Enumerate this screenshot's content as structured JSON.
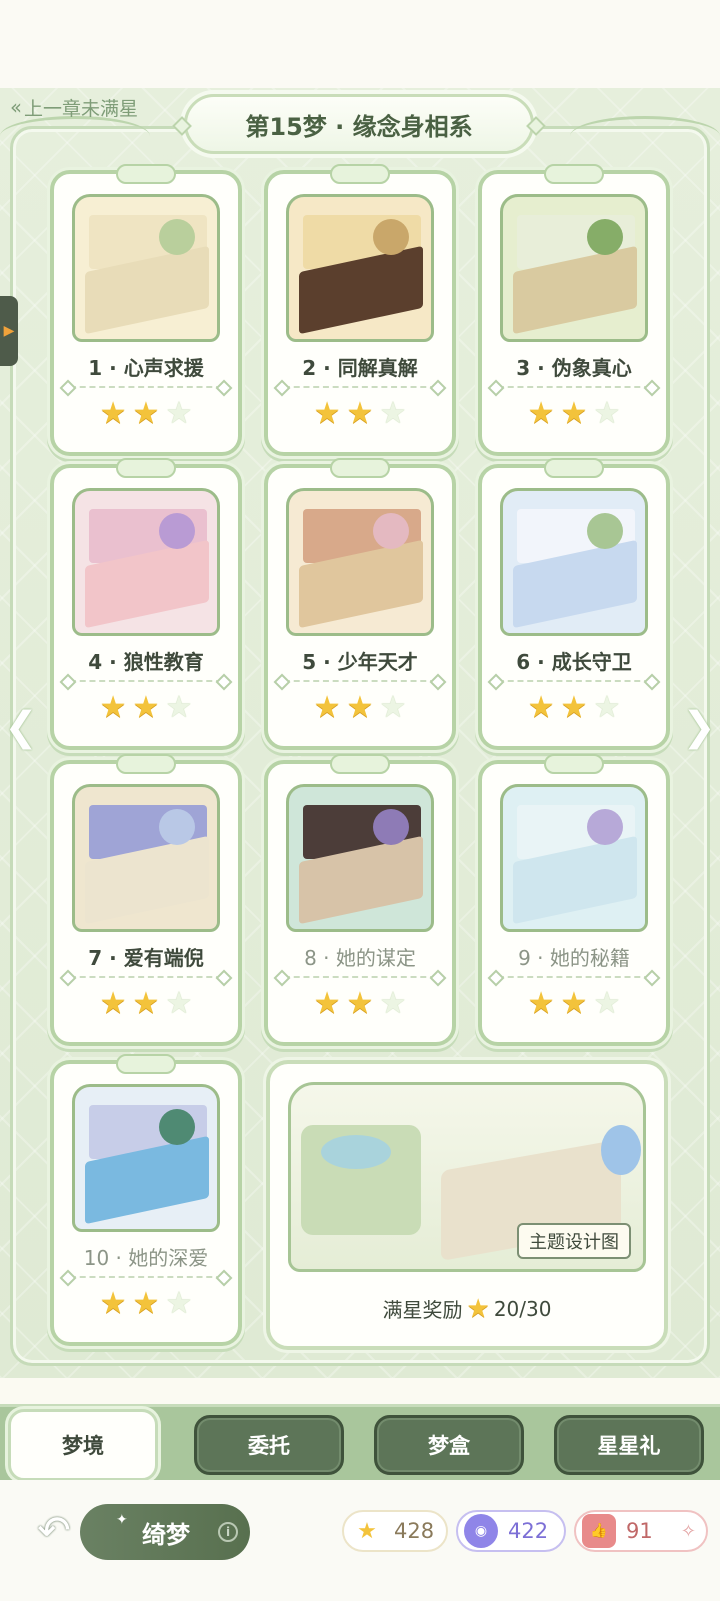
{
  "header": {
    "back_link": "上一章未满星",
    "chapter_title": "第15梦 · 缘念身相系"
  },
  "stages": [
    {
      "label": "1 · 心声求援",
      "stars": 2,
      "theme": "cream"
    },
    {
      "label": "2 · 同解真解",
      "stars": 2,
      "theme": "wood"
    },
    {
      "label": "3 · 伪象真心",
      "stars": 2,
      "theme": "garden"
    },
    {
      "label": "4 · 狼性教育",
      "stars": 2,
      "theme": "pink"
    },
    {
      "label": "5 · 少年天才",
      "stars": 2,
      "theme": "tan"
    },
    {
      "label": "6 · 成长守卫",
      "stars": 2,
      "theme": "blue"
    },
    {
      "label": "7 · 爱有端倪",
      "stars": 2,
      "theme": "violet"
    },
    {
      "label": "8 · 她的谋定",
      "stars": 2,
      "theme": "teal"
    },
    {
      "label": "9 · 她的秘籍",
      "stars": 2,
      "theme": "ice"
    },
    {
      "label": "10 · 她的深爱",
      "stars": 2,
      "theme": "ocean"
    }
  ],
  "reward": {
    "tag": "主题设计图",
    "label": "满星奖励",
    "progress": "20/30"
  },
  "tabs": [
    {
      "label": "梦境",
      "active": true
    },
    {
      "label": "委托",
      "active": false
    },
    {
      "label": "梦盒",
      "active": false
    },
    {
      "label": "星星礼",
      "active": false
    }
  ],
  "footer": {
    "mode_label": "绮梦",
    "info_icon": "i",
    "stars_count": "428",
    "gems_count": "422",
    "likes_count": "91"
  },
  "colors": {
    "accent_green": "#5d7558",
    "star_gold": "#f3c33b",
    "board_green": "#e3ecd8"
  }
}
